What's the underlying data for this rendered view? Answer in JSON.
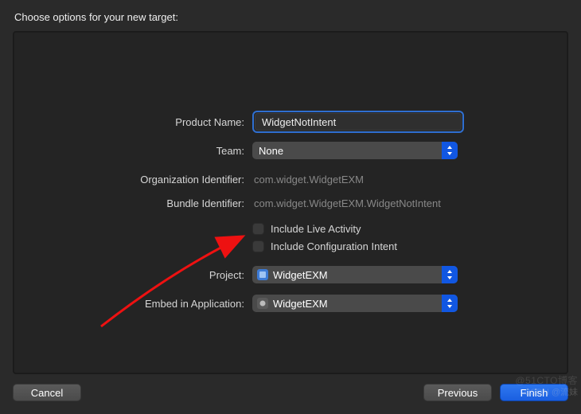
{
  "header": {
    "title": "Choose options for your new target:"
  },
  "form": {
    "product_name_label": "Product Name:",
    "product_name_value": "WidgetNotIntent",
    "team_label": "Team:",
    "team_value": "None",
    "org_id_label": "Organization Identifier:",
    "org_id_value": "com.widget.WidgetEXM",
    "bundle_id_label": "Bundle Identifier:",
    "bundle_id_value": "com.widget.WidgetEXM.WidgetNotIntent",
    "cb_live_activity_label": "Include Live Activity",
    "cb_config_intent_label": "Include Configuration Intent",
    "project_label": "Project:",
    "project_value": "WidgetEXM",
    "embed_label": "Embed in Application:",
    "embed_value": "WidgetEXM"
  },
  "buttons": {
    "cancel": "Cancel",
    "previous": "Previous",
    "finish": "Finish"
  },
  "watermark": {
    "a": "@51CTO博客",
    "b": "CSDN @流妹"
  }
}
